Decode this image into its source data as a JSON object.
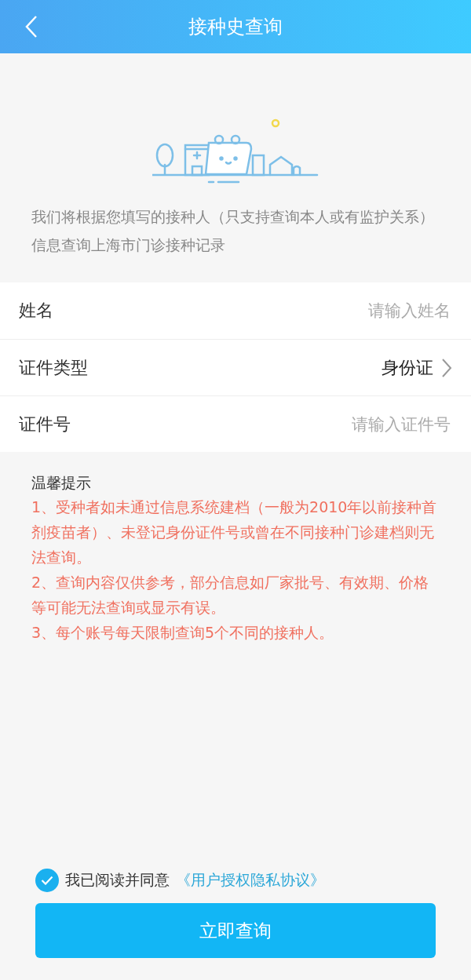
{
  "header": {
    "title": "接种史查询"
  },
  "intro": "我们将根据您填写的接种人（只支持查询本人或有监护关系）信息查询上海市门诊接种记录",
  "form": [
    {
      "kind": "input",
      "label": "姓名",
      "placeholder": "请输入姓名"
    },
    {
      "kind": "select",
      "label": "证件类型",
      "value": "身份证"
    },
    {
      "kind": "input",
      "label": "证件号",
      "placeholder": "请输入证件号"
    }
  ],
  "tips": {
    "title": "温馨提示",
    "items": [
      "1、受种者如未通过信息系统建档（一般为2010年以前接种首剂疫苗者）、未登记身份证件号或曾在不同接种门诊建档则无法查询。",
      "2、查询内容仅供参考，部分信息如厂家批号、有效期、价格等可能无法查询或显示有误。",
      "3、每个账号每天限制查询5个不同的接种人。"
    ]
  },
  "agreement": {
    "checked": true,
    "text": "我已阅读并同意",
    "link": "《用户授权隐私协议》"
  },
  "submit": "立即查询"
}
